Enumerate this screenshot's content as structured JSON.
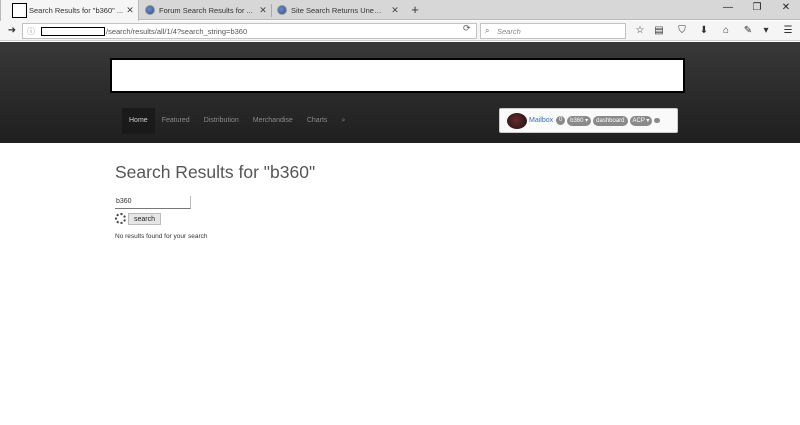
{
  "tabs": [
    {
      "title": "Search Results for \"b360\" ...",
      "active": true
    },
    {
      "title": "Forum Search Results for ...",
      "active": false
    },
    {
      "title": "Site Search Returns Unexp...",
      "active": false
    }
  ],
  "address_bar": {
    "url_visible": "/search/results/all/1/4?search_string=b360"
  },
  "search_bar": {
    "placeholder": "Search"
  },
  "main_nav": {
    "items": [
      "Home",
      "Featured",
      "Distribution",
      "Merchandise",
      "Charts"
    ]
  },
  "user_panel": {
    "mailbox": "Mailbox",
    "count": "0",
    "user": "b360 ▾",
    "dashboard": "dashboard",
    "acp": "ACP ▾"
  },
  "page": {
    "title": "Search Results for \"b360\"",
    "search_value": "b360",
    "search_button": "search",
    "no_results": "No results found for your search"
  }
}
